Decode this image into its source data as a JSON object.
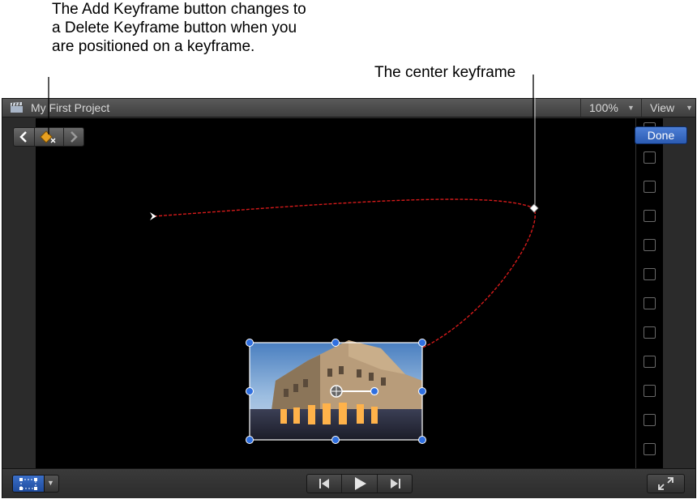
{
  "callouts": {
    "add_keyframe_note": "The Add Keyframe button changes to a Delete Keyframe button when you are positioned on a keyframe.",
    "center_keyframe_note": "The center keyframe"
  },
  "window": {
    "project_title": "My First Project",
    "zoom_level": "100%",
    "view_menu_label": "View"
  },
  "keyframe_nav": {
    "prev_icon": "chevron-left-icon",
    "delete_icon": "delete-keyframe-icon",
    "next_icon": "chevron-right-icon"
  },
  "done_button": {
    "label": "Done"
  },
  "side_checkboxes": [
    false,
    false,
    false,
    false,
    false,
    false,
    false,
    false,
    false,
    false,
    false,
    false
  ],
  "transport": {
    "start_icon": "go-to-start-icon",
    "play_icon": "play-icon",
    "end_icon": "go-to-end-icon"
  },
  "colors": {
    "motion_path": "#d41a1a",
    "handle_blue": "#2f6fe0",
    "done_blue": "#3a6cc6"
  }
}
